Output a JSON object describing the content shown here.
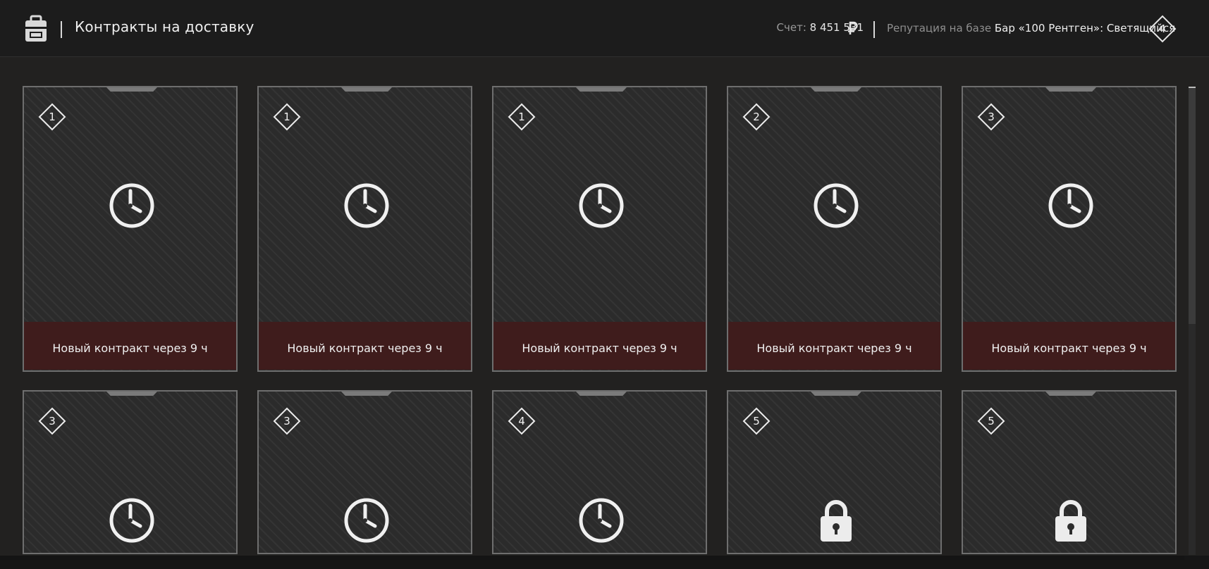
{
  "header": {
    "title": "Контракты на доставку",
    "score_label": "Счет:",
    "score_value": "8 451 531",
    "reputation_label": "Репутация на базе",
    "reputation_value": "Бар «100 Рентген»: Светящийся",
    "rank": "4"
  },
  "icons": {
    "header_left": "backpack-icon",
    "currency": "ruble-icon",
    "timer": "clock-icon",
    "locked": "lock-icon"
  },
  "colors": {
    "footer_bg": "#3f1c1c",
    "card_border": "#6e6e6e"
  },
  "contracts": [
    {
      "level": "1",
      "state": "timer",
      "status": "Новый контракт через 9 ч"
    },
    {
      "level": "1",
      "state": "timer",
      "status": "Новый контракт через 9 ч"
    },
    {
      "level": "1",
      "state": "timer",
      "status": "Новый контракт через 9 ч"
    },
    {
      "level": "2",
      "state": "timer",
      "status": "Новый контракт через 9 ч"
    },
    {
      "level": "3",
      "state": "timer",
      "status": "Новый контракт через 9 ч"
    },
    {
      "level": "3",
      "state": "timer",
      "status": ""
    },
    {
      "level": "3",
      "state": "timer",
      "status": ""
    },
    {
      "level": "4",
      "state": "timer",
      "status": ""
    },
    {
      "level": "5",
      "state": "locked",
      "status": ""
    },
    {
      "level": "5",
      "state": "locked",
      "status": ""
    }
  ]
}
